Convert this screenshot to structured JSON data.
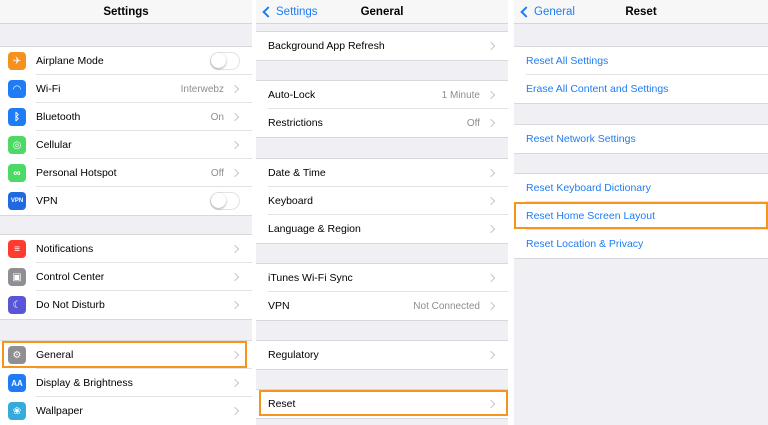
{
  "panel_settings": {
    "title": "Settings",
    "groups": [
      [
        {
          "label": "Airplane Mode",
          "control": "toggle",
          "icon": "airplane-icon",
          "color": "#f6911e"
        },
        {
          "label": "Wi-Fi",
          "value": "Interwebz",
          "icon": "wifi-icon",
          "color": "#1f7cf5"
        },
        {
          "label": "Bluetooth",
          "value": "On",
          "icon": "bluetooth-icon",
          "color": "#1f7cf5"
        },
        {
          "label": "Cellular",
          "icon": "cellular-icon",
          "color": "#4cd964"
        },
        {
          "label": "Personal Hotspot",
          "value": "Off",
          "icon": "hotspot-icon",
          "color": "#4cd964"
        },
        {
          "label": "VPN",
          "control": "toggle",
          "icon": "vpn-icon",
          "icon_text": "VPN",
          "color": "#1f6ae0"
        }
      ],
      [
        {
          "label": "Notifications",
          "icon": "notifications-icon",
          "color": "#ff3b30"
        },
        {
          "label": "Control Center",
          "icon": "control-center-icon",
          "color": "#8e8e93"
        },
        {
          "label": "Do Not Disturb",
          "icon": "moon-icon",
          "color": "#5856d6"
        }
      ],
      [
        {
          "label": "General",
          "icon": "gear-icon",
          "color": "#8e8e93"
        },
        {
          "label": "Display & Brightness",
          "icon": "display-icon",
          "icon_text": "AA",
          "color": "#1f7cf5"
        },
        {
          "label": "Wallpaper",
          "icon": "wallpaper-icon",
          "color": "#35aadc"
        }
      ]
    ]
  },
  "panel_general": {
    "back": "Settings",
    "title": "General",
    "groups": [
      [
        {
          "label": "Background App Refresh"
        }
      ],
      [
        {
          "label": "Auto-Lock",
          "value": "1 Minute"
        },
        {
          "label": "Restrictions",
          "value": "Off"
        }
      ],
      [
        {
          "label": "Date & Time"
        },
        {
          "label": "Keyboard"
        },
        {
          "label": "Language & Region"
        }
      ],
      [
        {
          "label": "iTunes Wi-Fi Sync"
        },
        {
          "label": "VPN",
          "value": "Not Connected"
        }
      ],
      [
        {
          "label": "Regulatory"
        }
      ],
      [
        {
          "label": "Reset"
        }
      ]
    ]
  },
  "panel_reset": {
    "back": "General",
    "title": "Reset",
    "groups": [
      [
        {
          "label": "Reset All Settings"
        },
        {
          "label": "Erase All Content and Settings"
        }
      ],
      [
        {
          "label": "Reset Network Settings"
        }
      ],
      [
        {
          "label": "Reset Keyboard Dictionary"
        },
        {
          "label": "Reset Home Screen Layout"
        },
        {
          "label": "Reset Location & Privacy"
        }
      ]
    ]
  },
  "colors": {
    "accent": "#1f7cf5",
    "highlight": "#f7941d",
    "background": "#efeff4"
  }
}
